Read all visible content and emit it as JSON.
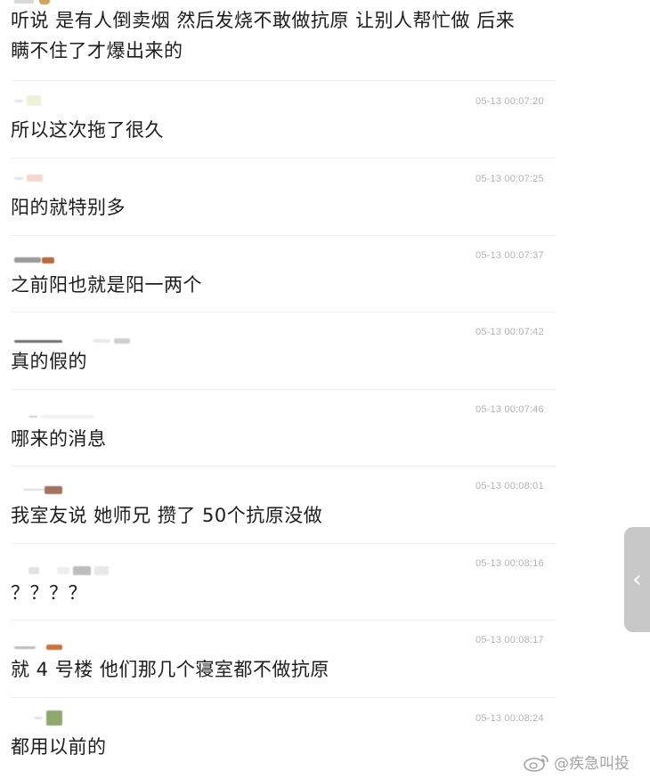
{
  "messages": [
    {
      "text": "听说 是有人倒卖烟 然后发烧不敢做抗原 让别人帮忙做 后来\n瞒不住了才爆出来的",
      "time": ""
    },
    {
      "text": "所以这次拖了很久",
      "time": "05-13 00:07:20"
    },
    {
      "text": "阳的就特别多",
      "time": "05-13 00:07:25"
    },
    {
      "text": "之前阳也就是阳一两个",
      "time": "05-13 00:07:37"
    },
    {
      "text": "真的假的",
      "time": "05-13 00:07:42"
    },
    {
      "text": "哪来的消息",
      "time": "05-13 00:07:46"
    },
    {
      "text": "我室友说 她师兄 攒了 50个抗原没做",
      "time": "05-13 00:08:01"
    },
    {
      "text": "？？？？",
      "time": "05-13 00:08:16"
    },
    {
      "text": "就 4 号楼 他们那几个寝室都不做抗原",
      "time": "05-13 00:08:17"
    },
    {
      "text": "都用以前的",
      "time": "05-13 00:08:24"
    }
  ],
  "side_handle": {
    "icon": "chevron-left-icon",
    "glyph": "‹"
  },
  "watermark": {
    "icon": "weibo-logo-icon",
    "text": "@疾急叫投"
  },
  "colors": {
    "timestamp": "#b3b3b3",
    "divider": "#ececec",
    "handle": "#c8c8c8"
  }
}
